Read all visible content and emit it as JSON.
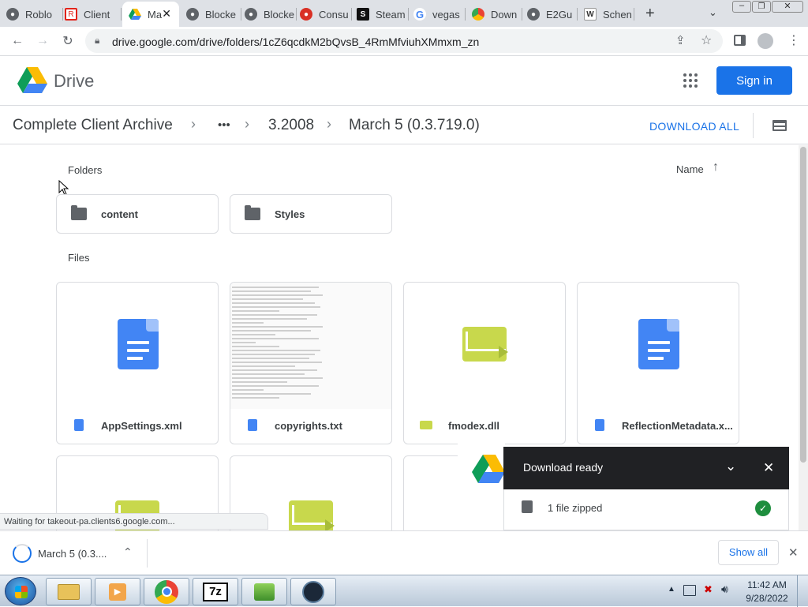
{
  "browser": {
    "tabs": [
      {
        "label": "Roblo",
        "favicon": "globe-icon"
      },
      {
        "label": "Client",
        "favicon": "roblox-icon"
      },
      {
        "label": "Ma",
        "favicon": "google-drive-icon",
        "active": true
      },
      {
        "label": "Blocke",
        "favicon": "globe-icon"
      },
      {
        "label": "Blocke",
        "favicon": "globe-icon"
      },
      {
        "label": "Consu",
        "favicon": "opera-icon"
      },
      {
        "label": "Steam",
        "favicon": "steam-icon"
      },
      {
        "label": "vegas",
        "favicon": "google-icon"
      },
      {
        "label": "Down",
        "favicon": "chrome-icon"
      },
      {
        "label": "E2Gu",
        "favicon": "globe-icon"
      },
      {
        "label": "Schen",
        "favicon": "wiki-icon"
      }
    ],
    "url": "drive.google.com/drive/folders/1cZ6qcdkM2bQvsB_4RmMfviuhXMmxm_zn"
  },
  "drive": {
    "brand": "Drive",
    "signin_label": "Sign in",
    "breadcrumb": {
      "root": "Complete Client Archive",
      "more": "•••",
      "parent": "3.2008",
      "current": "March 5 (0.3.719.0)"
    },
    "download_all_label": "DOWNLOAD ALL",
    "folders_label": "Folders",
    "sort_label": "Name",
    "folders": [
      {
        "name": "content"
      },
      {
        "name": "Styles"
      }
    ],
    "files_label": "Files",
    "files": [
      {
        "name": "AppSettings.xml",
        "kind": "doc"
      },
      {
        "name": "copyrights.txt",
        "kind": "text"
      },
      {
        "name": "fmodex.dll",
        "kind": "binary"
      },
      {
        "name": "ReflectionMetadata.x...",
        "kind": "doc"
      }
    ]
  },
  "status_text": "Waiting for takeout-pa.clients6.google.com...",
  "toast": {
    "title": "Download ready",
    "item": "1 file zipped"
  },
  "shelf": {
    "item_label": "March 5 (0.3....",
    "show_all_label": "Show all"
  },
  "taskbar": {
    "time": "11:42 AM",
    "date": "9/28/2022"
  },
  "colors": {
    "accent": "#1a73e8",
    "toast_bg": "#202124",
    "success": "#1e8e3e"
  }
}
